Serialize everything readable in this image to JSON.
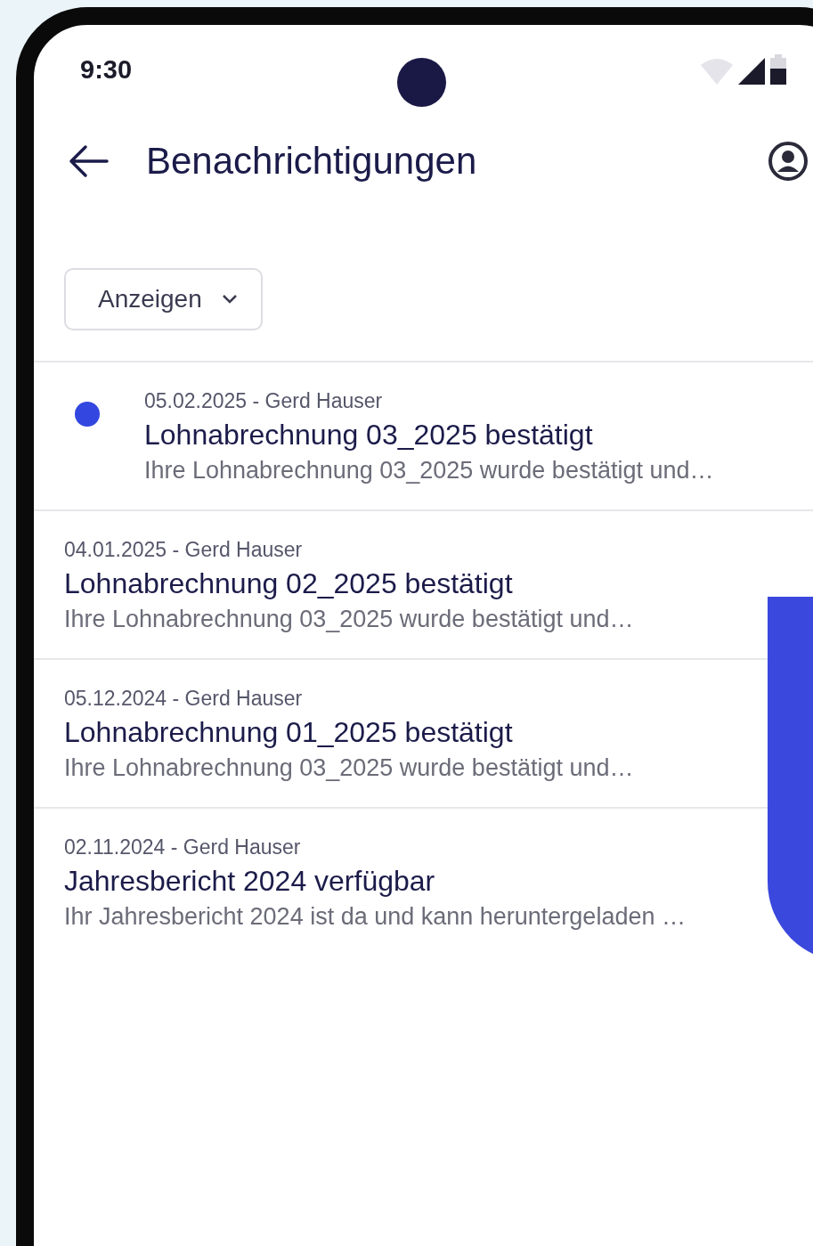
{
  "status_bar": {
    "time": "9:30"
  },
  "header": {
    "title": "Benachrichtigungen"
  },
  "filter": {
    "label": "Anzeigen"
  },
  "notifications": [
    {
      "unread": true,
      "meta": "05.02.2025 - Gerd Hauser",
      "title": "Lohnabrechnung 03_2025 bestätigt",
      "preview": "Ihre Lohnabrechnung 03_2025 wurde bestätigt und…"
    },
    {
      "unread": false,
      "meta": "04.01.2025 - Gerd Hauser",
      "title": "Lohnabrechnung 02_2025 bestätigt",
      "preview": "Ihre Lohnabrechnung 03_2025 wurde bestätigt und…"
    },
    {
      "unread": false,
      "meta": "05.12.2024 - Gerd Hauser",
      "title": "Lohnabrechnung 01_2025 bestätigt",
      "preview": "Ihre Lohnabrechnung 03_2025 wurde bestätigt und…"
    },
    {
      "unread": false,
      "meta": "02.11.2024 - Gerd Hauser",
      "title": "Jahresbericht 2024 verfügbar",
      "preview": "Ihr Jahresbericht 2024 ist da und kann heruntergeladen …"
    }
  ]
}
